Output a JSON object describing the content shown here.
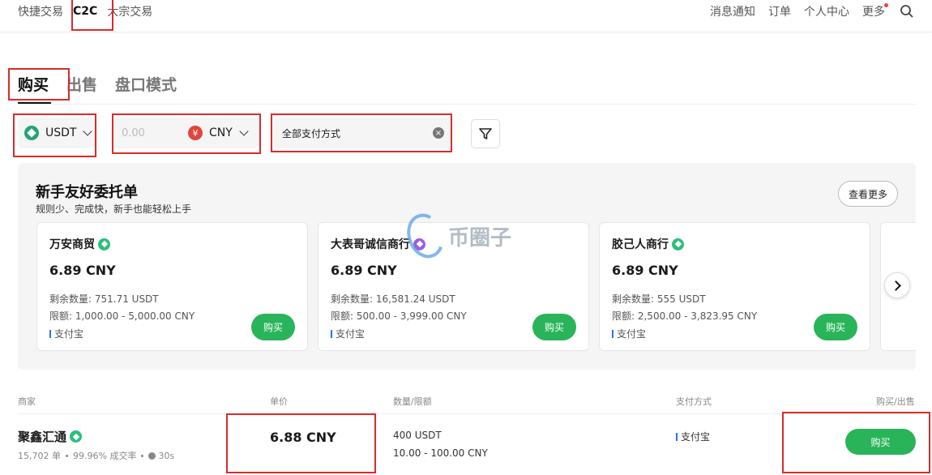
{
  "topnav": {
    "left": [
      "快捷交易",
      "C2C",
      "大宗交易"
    ],
    "right": [
      "消息通知",
      "订单",
      "个人中心",
      "更多"
    ]
  },
  "tabs": [
    "购买",
    "出售",
    "盘口模式"
  ],
  "filters": {
    "coin": "USDT",
    "amount_placeholder": "0.00",
    "currency": "CNY",
    "currency_symbol": "¥",
    "payment": "全部支付方式",
    "clear_symbol": "×"
  },
  "promo": {
    "title": "新手友好委托单",
    "subtitle": "规则少、完成快，新手也能轻松上手",
    "see_more": "查看更多",
    "cards": [
      {
        "merchant": "万安商贸",
        "price": "6.89 CNY",
        "available": "剩余数量: 751.71 USDT",
        "limit": "限额: 1,000.00 - 5,000.00 CNY",
        "payment": "支付宝",
        "buy": "购买"
      },
      {
        "merchant": "大表哥诚信商行",
        "price": "6.89 CNY",
        "available": "剩余数量: 16,581.24 USDT",
        "limit": "限额: 500.00 - 3,999.00 CNY",
        "payment": "支付宝",
        "buy": "购买"
      },
      {
        "merchant": "胶己人商行",
        "price": "6.89 CNY",
        "available": "剩余数量: 555 USDT",
        "limit": "限额: 2,500.00 - 3,823.95 CNY",
        "payment": "支付宝",
        "buy": "购买"
      }
    ]
  },
  "watermark": "币圈子",
  "table": {
    "headers": [
      "商家",
      "单价",
      "数量/限额",
      "支付方式",
      "购买/出售"
    ],
    "rows": [
      {
        "merchant": "聚鑫汇通",
        "orders": "15,702 单",
        "rate": "99.96% 成交率",
        "time": "30s",
        "price": "6.88 CNY",
        "qty": "400 USDT",
        "limit": "10.00 - 100.00 CNY",
        "payment": "支付宝",
        "action": "购买"
      }
    ]
  }
}
